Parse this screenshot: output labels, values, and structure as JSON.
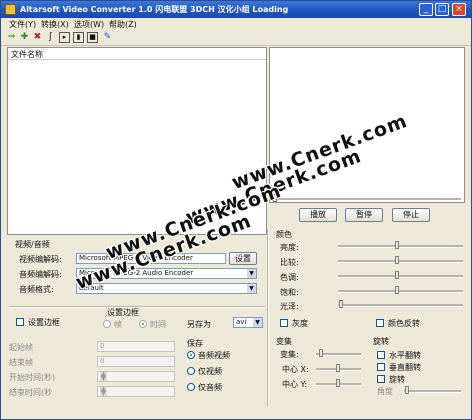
{
  "window": {
    "title": "Altarsoft Video Converter 1.0 闪电联盟 3DCH 汉化小组 Loading",
    "min": "_",
    "max": "□",
    "close": "×"
  },
  "menu": [
    "文件(Y)",
    "转换(X)",
    "选项(W)",
    "帮助(Z)"
  ],
  "toolbar": {
    "icons": [
      "add-icon",
      "add-plus-icon",
      "remove-icon",
      "clear-icon",
      "play-icon",
      "pause-icon",
      "stop-icon",
      "settings-icon"
    ],
    "glyphs": [
      "⇒",
      "✚",
      "✖",
      "ʃ",
      "▸",
      "▮",
      "■",
      "✎"
    ]
  },
  "file_list": {
    "header": "文件名称"
  },
  "preview": {
    "play": "播放",
    "pause": "暂停",
    "stop": "停止"
  },
  "av": {
    "section": "视频/音频",
    "video_codec_label": "视频编解码:",
    "video_codec_value": "Microsoft MPEG-4 Video Encoder",
    "video_settings": "设置",
    "audio_codec_label": "音频编解码:",
    "audio_codec_value": "Microsoft MPEG-2 Audio Encoder",
    "audio_format_label": "音频格式:",
    "audio_format_value": "default"
  },
  "color": {
    "section": "颜色",
    "rows": [
      "亮度:",
      "比较:",
      "色调:",
      "饱和:",
      "光泽:"
    ],
    "grayscale": "灰度",
    "invert": "颜色反转"
  },
  "frame": {
    "set_frame": "设置边框",
    "set_frame_group": "设置边框",
    "radio_frame": "帧",
    "radio_time": "时间",
    "start_frame": "起始帧",
    "end_frame": "结束帧",
    "start_time": "开始时间(秒)",
    "end_time": "结束时间(秒",
    "values": [
      "0",
      "0",
      "0",
      "0"
    ]
  },
  "save": {
    "save_as_label": "另存为",
    "save_as_value": "avi",
    "group": "保存",
    "options": [
      "音频视频",
      "仅视频",
      "仅音频"
    ]
  },
  "transform": {
    "section": "变集",
    "scale": "变集:",
    "center_x": "中心 X:",
    "center_y": "中心 Y:"
  },
  "rotate": {
    "section": "旋转",
    "hflip": "水平翻转",
    "vflip": "垂直翻转",
    "rotate": "旋转",
    "angle": "角度"
  },
  "watermark": [
    "www.Cnerk.com",
    "www.Cnerk.com",
    "www.Cnerk.com",
    "www.Cnerk.com"
  ]
}
